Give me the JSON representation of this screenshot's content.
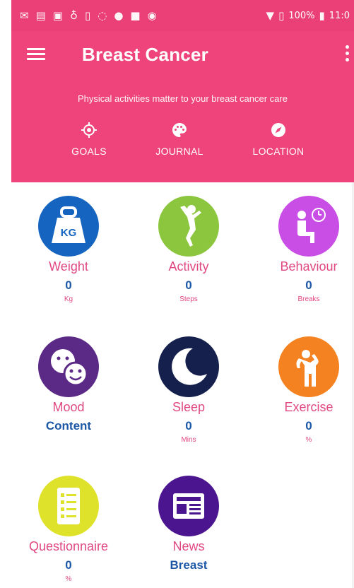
{
  "status_bar": {
    "battery_percent": "100%",
    "time": "11:0"
  },
  "header": {
    "title": "Breast Cancer",
    "subtitle": "Physical activities matter to your breast cancer care",
    "tabs": [
      {
        "label": "GOALS",
        "icon": "target-icon"
      },
      {
        "label": "JOURNAL",
        "icon": "palette-icon"
      },
      {
        "label": "LOCATION",
        "icon": "compass-icon"
      }
    ]
  },
  "grid": [
    {
      "label": "Weight",
      "value": "0",
      "unit": "Kg",
      "color": "#1565c0",
      "icon": "kettlebell-kg-icon",
      "icon_text": "KG"
    },
    {
      "label": "Activity",
      "value": "0",
      "unit": "Steps",
      "color": "#8cc63f",
      "icon": "jumping-person-icon"
    },
    {
      "label": "Behaviour",
      "value": "0",
      "unit": "Breaks",
      "color": "#c94ee5",
      "icon": "sitting-person-clock-icon"
    },
    {
      "label": "Mood",
      "value": "Content",
      "unit": "",
      "color": "#5b2a86",
      "icon": "smiley-faces-icon"
    },
    {
      "label": "Sleep",
      "value": "0",
      "unit": "Mins",
      "color": "#16204d",
      "icon": "crescent-moon-icon"
    },
    {
      "label": "Exercise",
      "value": "0",
      "unit": "%",
      "color": "#f58220",
      "icon": "stretching-person-icon"
    },
    {
      "label": "Questionnaire",
      "value": "0",
      "unit": "%",
      "color": "#dfe22a",
      "icon": "checklist-icon"
    },
    {
      "label": "News",
      "value": "Breast",
      "unit": "",
      "color": "#4b1590",
      "icon": "newspaper-icon"
    }
  ],
  "colors": {
    "header_pink": "#ee447b",
    "label_pink": "#e04882",
    "value_blue": "#1d58a6"
  }
}
